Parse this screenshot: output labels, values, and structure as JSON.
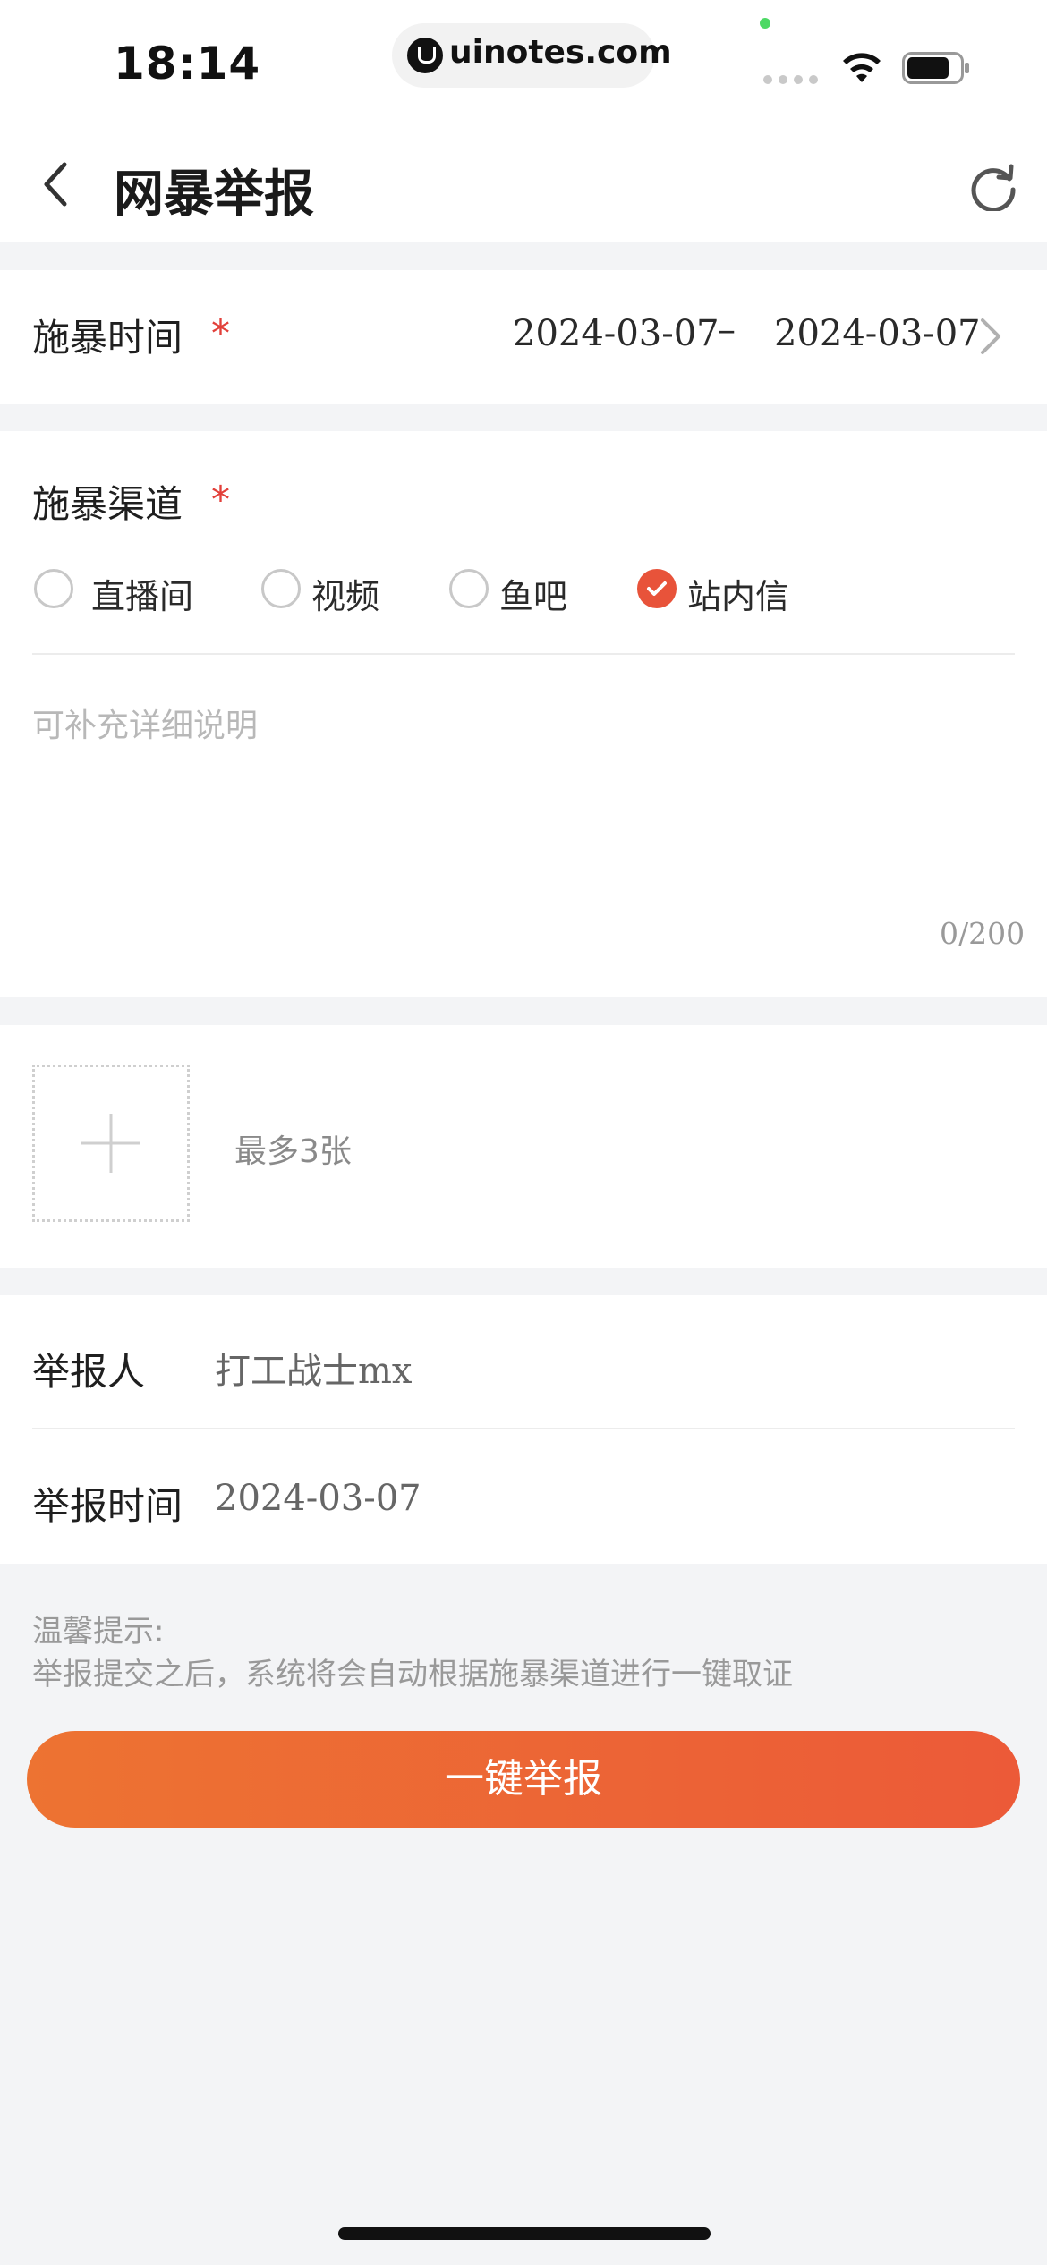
{
  "status_bar": {
    "time": "18:14",
    "url": "uinotes.com",
    "icons": [
      "signal-icon",
      "wifi-icon",
      "battery-icon"
    ]
  },
  "nav": {
    "title": "网暴举报",
    "back_icon": "chevron-left-icon",
    "refresh_icon": "refresh-icon"
  },
  "form": {
    "time_section": {
      "label": "施暴时间",
      "required_mark": "*",
      "start_date": "2024-03-07",
      "separator": "–",
      "end_date": "2024-03-07"
    },
    "channel_section": {
      "label": "施暴渠道",
      "required_mark": "*",
      "options": [
        {
          "label": "直播间",
          "checked": false
        },
        {
          "label": "视频",
          "checked": false
        },
        {
          "label": "鱼吧",
          "checked": false
        },
        {
          "label": "站内信",
          "checked": true
        }
      ],
      "detail_placeholder": "可补充详细说明",
      "counter": "0/200"
    },
    "upload_section": {
      "hint": "最多3张"
    },
    "reporter_section": {
      "reporter_label": "举报人",
      "reporter_value": "打工战士mx",
      "report_time_label": "举报时间",
      "report_time_value": "2024-03-07"
    }
  },
  "tips": {
    "title": "温馨提示:",
    "body": "举报提交之后，系统将会自动根据施暴渠道进行一键取证"
  },
  "submit_label": "一键举报",
  "colors": {
    "accent": "#e8533a",
    "required": "#e2403a",
    "button_gradient_start": "#ed7332",
    "button_gradient_end": "#ec5a38",
    "page_bg": "#f3f4f6"
  }
}
